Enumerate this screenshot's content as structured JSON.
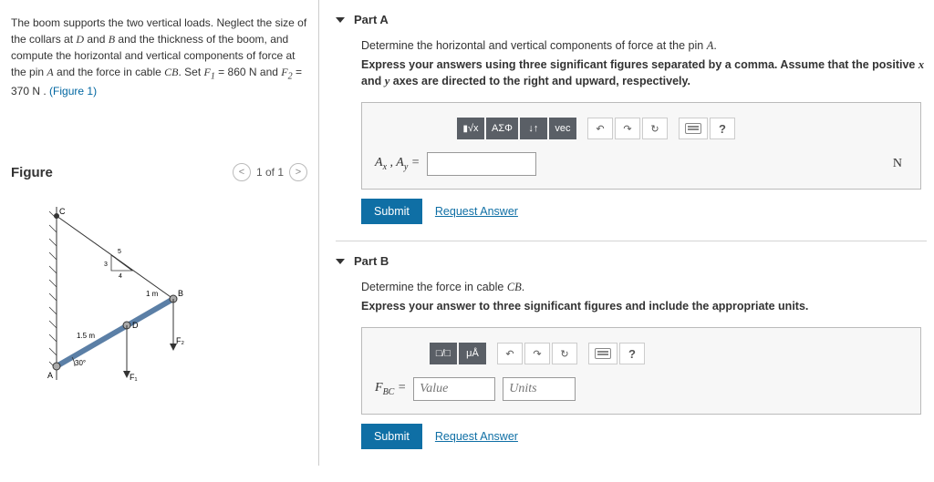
{
  "problem": {
    "text_1": "The boom supports the two vertical loads. Neglect the size of the collars at ",
    "D": "D",
    "and": " and ",
    "B": "B",
    "text_2": " and the thickness of the boom, and compute the horizontal and vertical components of force at the pin ",
    "A": "A",
    "text_3": " and the force in cable ",
    "CB": "CB",
    "text_4": ". Set ",
    "F1": "F",
    "F1sub": "1",
    "eq": " = ",
    "v1": "860 N",
    "andw": " and ",
    "F2": "F",
    "F2sub": "2",
    "v2": "370 N",
    "dot": " . ",
    "figlink": "(Figure 1)"
  },
  "figure": {
    "title": "Figure",
    "nav_label": "1 of 1",
    "prev": "<",
    "next": ">",
    "labels": {
      "C": "C",
      "B": "B",
      "D": "D",
      "A": "A",
      "F1": "F₁",
      "F2": "F₂",
      "d1": "1 m",
      "d2": "1.5 m",
      "ang": "30°",
      "s3": "3",
      "s4": "4",
      "s5": "5"
    }
  },
  "partA": {
    "title": "Part A",
    "instruction_1": "Determine the horizontal and vertical components of force at the pin ",
    "instruction_A": "A",
    "instruction_dot": ".",
    "bold_1": "Express your answers using three significant figures separated by a comma. Assume that the positive ",
    "x": "x",
    "bold_2": " and ",
    "y": "y",
    "bold_3": " axes are directed to the right and upward, respectively.",
    "toolbar": {
      "eq": "√x",
      "greek": "ΑΣΦ",
      "arrows": "↓↑",
      "vec": "vec",
      "undo": "↶",
      "redo": "↷",
      "reset": "↻",
      "help": "?"
    },
    "lhs_Ax": "A",
    "lhs_Ax_sub": "x",
    "comma": " , ",
    "lhs_Ay": "A",
    "lhs_Ay_sub": "y",
    "equals": " = ",
    "unit": "N",
    "submit": "Submit",
    "request": "Request Answer"
  },
  "partB": {
    "title": "Part B",
    "instruction_1": "Determine the force in cable ",
    "CB": "CB",
    "dot": ".",
    "bold": "Express your answer to three significant figures and include the appropriate units.",
    "toolbar": {
      "frac": "□/□",
      "mu": "μÅ",
      "undo": "↶",
      "redo": "↷",
      "reset": "↻",
      "help": "?"
    },
    "lhs": "F",
    "lhs_sub": "BC",
    "equals": " = ",
    "value_ph": "Value",
    "units_ph": "Units",
    "submit": "Submit",
    "request": "Request Answer"
  }
}
